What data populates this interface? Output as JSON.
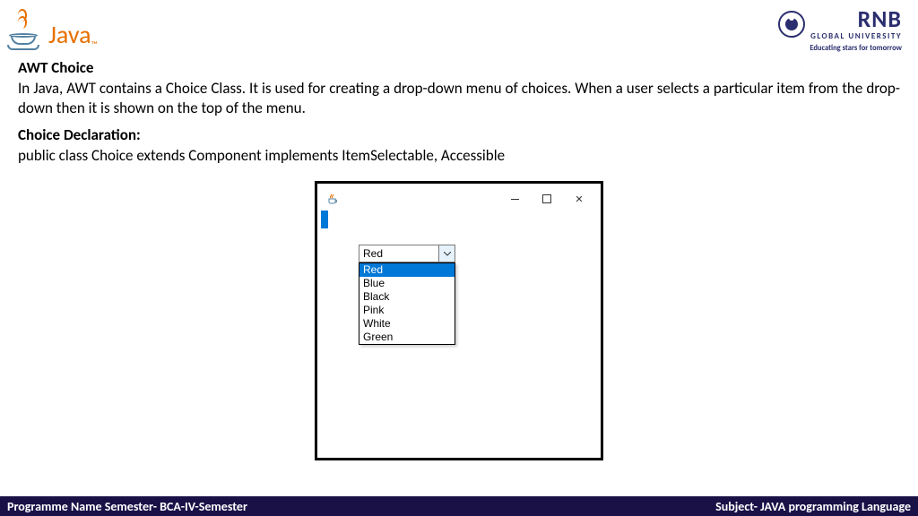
{
  "header": {
    "java_brand": "Java",
    "rnb_brand": "RNB",
    "rnb_subtitle": "GLOBAL UNIVERSITY",
    "rnb_tagline": "Educating stars for tomorrow"
  },
  "content": {
    "title": "AWT Choice",
    "description": "In Java, AWT contains a Choice Class. It is used for creating a drop-down menu of choices. When a user selects a particular item from the drop-down then it is shown on the top of the menu.",
    "sub_title": "Choice Declaration:",
    "declaration": "public class Choice extends Component implements ItemSelectable, Accessible"
  },
  "window": {
    "choice": {
      "selected": "Red",
      "options": [
        "Red",
        "Blue",
        "Black",
        "Pink",
        "White",
        "Green"
      ],
      "highlighted_index": 0
    }
  },
  "footer": {
    "left": "Programme Name Semester- BCA-IV-Semester",
    "right": "Subject- JAVA programming Language"
  }
}
